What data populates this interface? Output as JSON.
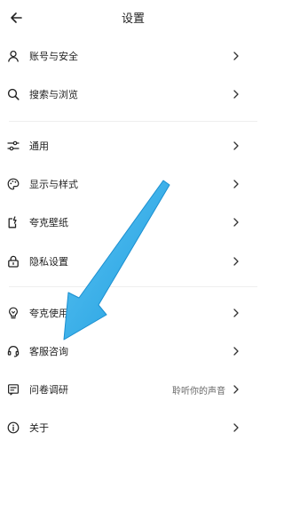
{
  "header": {
    "title": "设置"
  },
  "menu": {
    "account": {
      "label": "账号与安全"
    },
    "search_browse": {
      "label": "搜索与浏览"
    },
    "general": {
      "label": "通用"
    },
    "display": {
      "label": "显示与样式"
    },
    "wallpaper": {
      "label": "夸克壁纸"
    },
    "privacy": {
      "label": "隐私设置"
    },
    "usage": {
      "label": "夸克使用"
    },
    "support": {
      "label": "客服咨询"
    },
    "survey": {
      "label": "问卷调研",
      "sub": "聆听你的声音"
    },
    "about": {
      "label": "关于"
    }
  },
  "colors": {
    "annotation_arrow": "#29a9e6"
  },
  "icons": [
    "back-arrow-icon",
    "person-icon",
    "search-icon",
    "sliders-icon",
    "palette-icon",
    "wallpaper-icon",
    "lock-icon",
    "lightbulb-icon",
    "headset-icon",
    "survey-icon",
    "info-icon",
    "chevron-right-icon"
  ]
}
